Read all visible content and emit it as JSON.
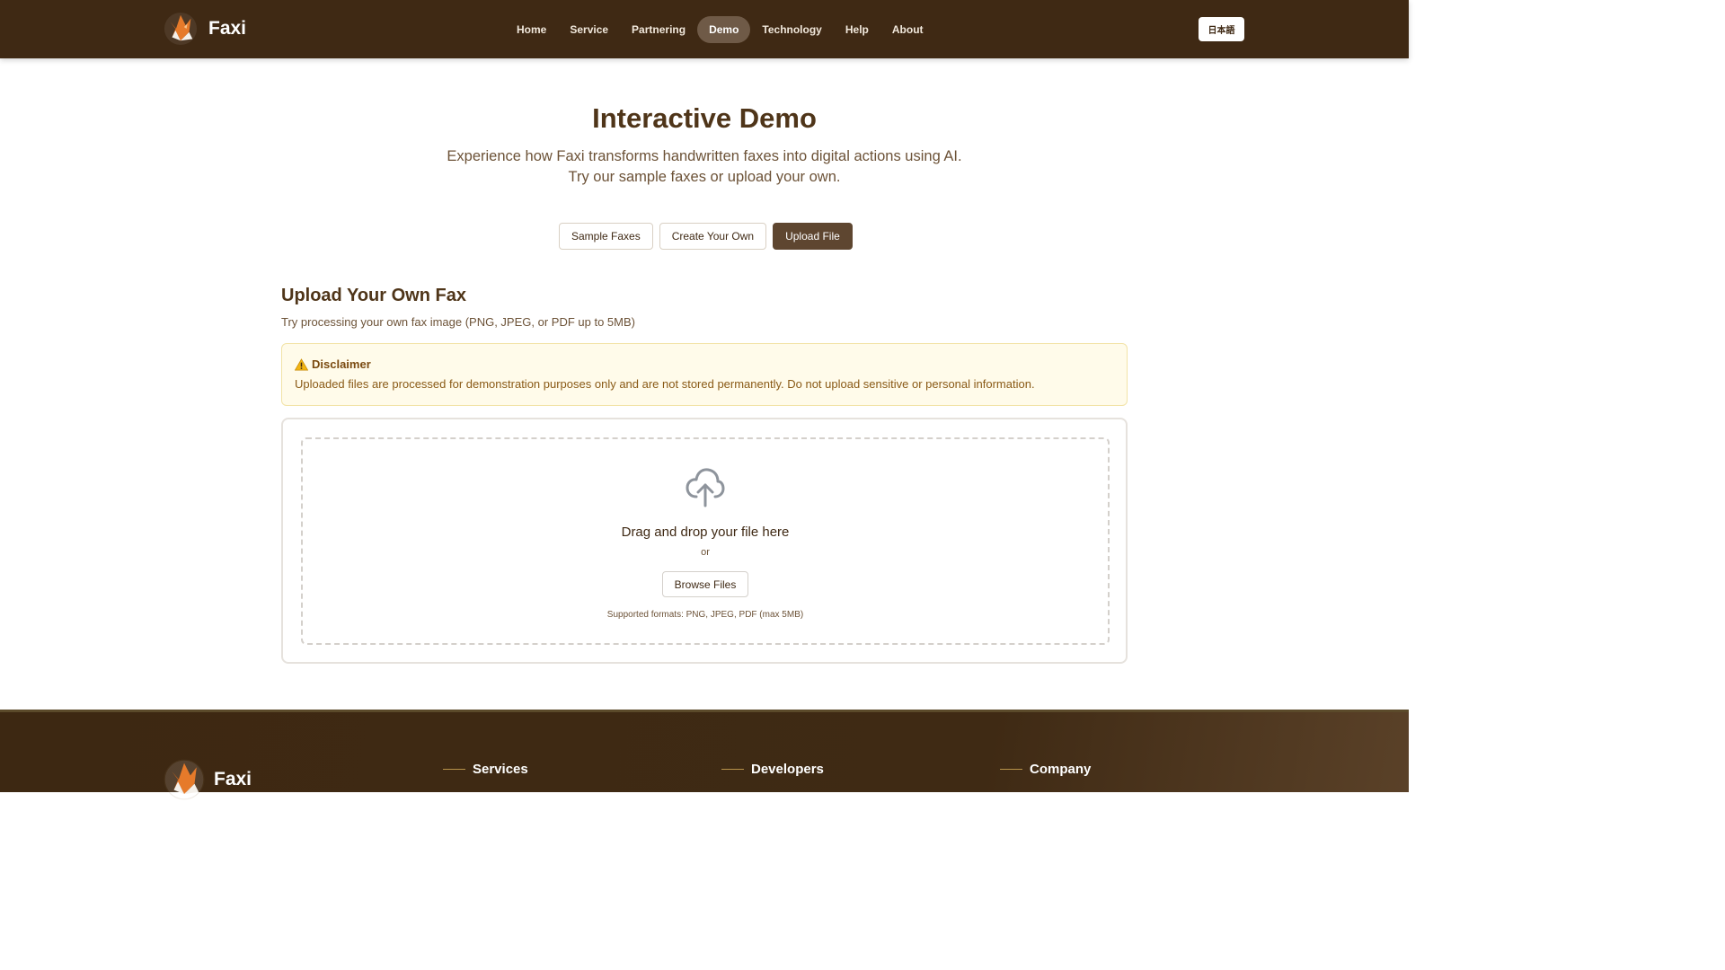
{
  "header": {
    "brand": "Faxi",
    "nav": [
      {
        "label": "Home",
        "active": false
      },
      {
        "label": "Service",
        "active": false
      },
      {
        "label": "Partnering",
        "active": false
      },
      {
        "label": "Demo",
        "active": true
      },
      {
        "label": "Technology",
        "active": false
      },
      {
        "label": "Help",
        "active": false
      },
      {
        "label": "About",
        "active": false
      }
    ],
    "language_button": "日本語"
  },
  "hero": {
    "title": "Interactive Demo",
    "subtitle": "Experience how Faxi transforms handwritten faxes into digital actions using AI. Try our sample faxes or upload your own."
  },
  "tabs": [
    {
      "label": "Sample Faxes",
      "active": false
    },
    {
      "label": "Create Your Own",
      "active": false
    },
    {
      "label": "Upload File",
      "active": true
    }
  ],
  "upload": {
    "title": "Upload Your Own Fax",
    "subtitle": "Try processing your own fax image (PNG, JPEG, or PDF up to 5MB)",
    "disclaimer": {
      "title": "Disclaimer",
      "text": "Uploaded files are processed for demonstration purposes only and are not stored permanently. Do not upload sensitive or personal information."
    },
    "dropzone": {
      "title": "Drag and drop your file here",
      "or": "or",
      "browse_label": "Browse Files",
      "formats": "Supported formats: PNG, JPEG, PDF (max 5MB)"
    }
  },
  "footer": {
    "brand": "Faxi",
    "columns": [
      "Services",
      "Developers",
      "Company"
    ]
  },
  "colors": {
    "header_bg": "#3f2914",
    "accent_brown": "#5e4630",
    "disclaimer_bg": "#fffbea",
    "disclaimer_text": "#8a5a16"
  },
  "icons": {
    "logo": "fox-logo",
    "warning": "warning-icon",
    "upload": "cloud-upload-icon"
  }
}
